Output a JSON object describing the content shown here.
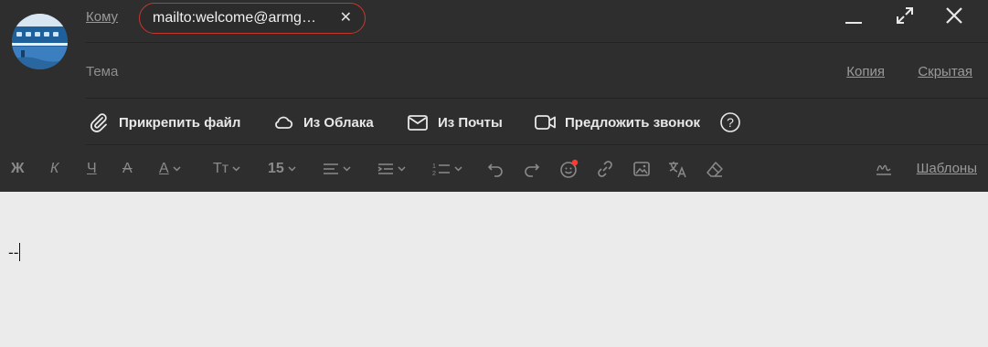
{
  "header": {
    "to_label": "Кому",
    "recipient": "mailto:welcome@armg…",
    "remove_recipient": "✕"
  },
  "subject": {
    "placeholder": "Тема",
    "cc_label": "Копия",
    "bcc_label": "Скрытая"
  },
  "attachments": {
    "attach_file": "Прикрепить файл",
    "from_cloud": "Из Облака",
    "from_mail": "Из Почты",
    "suggest_call": "Предложить звонок",
    "help": "?"
  },
  "toolbar": {
    "bold": "Ж",
    "italic": "К",
    "underline": "Ч",
    "strike": "А",
    "text_color": "А",
    "font_style": "Тт",
    "font_size": "15",
    "templates": "Шаблоны"
  },
  "body": {
    "signature": "--"
  },
  "colors": {
    "panel": "#2e2e2e",
    "body_bg": "#ebebeb",
    "chip_border": "#c8372f",
    "emoji_dot": "#ff3b30"
  }
}
